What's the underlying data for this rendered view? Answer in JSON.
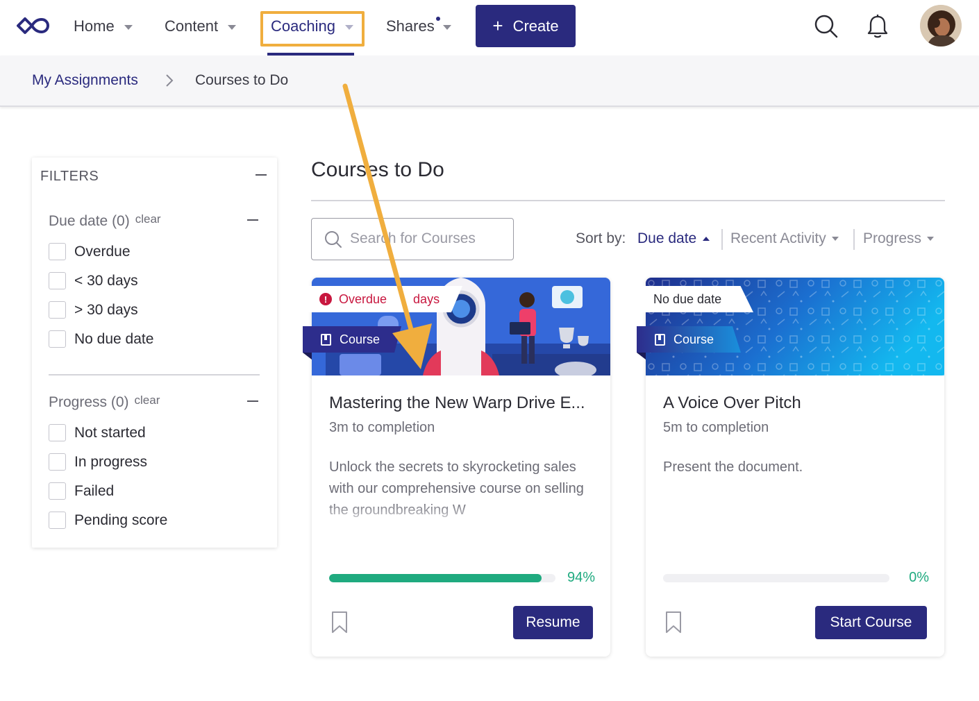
{
  "nav": {
    "items": [
      {
        "label": "Home"
      },
      {
        "label": "Content"
      },
      {
        "label": "Coaching"
      },
      {
        "label": "Shares"
      }
    ],
    "create_label": "Create",
    "icons": [
      "infinity-logo-icon",
      "search-icon",
      "bell-icon"
    ]
  },
  "breadcrumb": {
    "link": "My Assignments",
    "current": "Courses to Do"
  },
  "filters": {
    "title": "FILTERS",
    "due_date": {
      "title": "Due date (0)",
      "clear": "clear",
      "options": [
        "Overdue",
        "< 30 days",
        "> 30 days",
        "No due date"
      ]
    },
    "progress": {
      "title": "Progress (0)",
      "clear": "clear",
      "options": [
        "Not started",
        "In progress",
        "Failed",
        "Pending score"
      ]
    }
  },
  "main": {
    "title": "Courses to Do",
    "search_placeholder": "Search for Courses",
    "sort": {
      "label": "Sort by:",
      "options": [
        "Due date",
        "Recent Activity",
        "Progress"
      ],
      "active": "Due date"
    }
  },
  "cards": [
    {
      "due": "Overdue",
      "due_days": "days",
      "type": "Course",
      "name": "Mastering the New Warp Drive E...",
      "time": "3m to completion",
      "desc": "Unlock the secrets to skyrocketing sales with our comprehensive course on selling the groundbreaking W",
      "progress_label": "94%",
      "progress": 0.94,
      "action": "Resume"
    },
    {
      "due": "No due date",
      "type": "Course",
      "name": "A Voice Over Pitch",
      "time": "5m to completion",
      "desc": "Present the document.",
      "progress_label": "0%",
      "progress": 0,
      "action": "Start Course"
    }
  ],
  "colors": {
    "brand": "#2a2a7e",
    "highlight": "#f0ae3e",
    "overdue": "#c8173f",
    "progress": "#1faa7f"
  }
}
